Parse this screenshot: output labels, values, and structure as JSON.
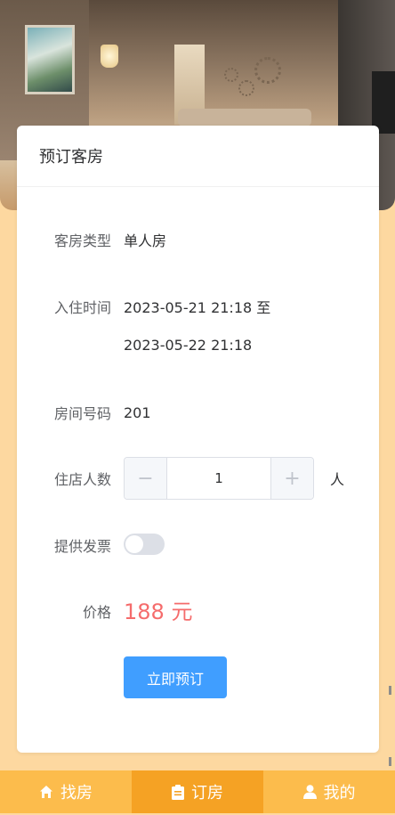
{
  "card": {
    "title": "预订客房"
  },
  "form": {
    "room_type_label": "客房类型",
    "room_type_value": "单人房",
    "checkin_label": "入住时间",
    "checkin_start": "2023-05-21 21:18 至",
    "checkin_end": "2023-05-22 21:18",
    "room_number_label": "房间号码",
    "room_number_value": "201",
    "guests_label": "住店人数",
    "guests_minus": "−",
    "guests_value": "1",
    "guests_plus": "+",
    "guests_unit": "人",
    "invoice_label": "提供发票",
    "invoice_enabled": false,
    "price_label": "价格",
    "price_value": "188 元",
    "book_button": "立即预订"
  },
  "tabbar": {
    "items": [
      {
        "label": "找房",
        "icon": "home-icon",
        "active": false
      },
      {
        "label": "订房",
        "icon": "clipboard-icon",
        "active": true
      },
      {
        "label": "我的",
        "icon": "user-icon",
        "active": false
      }
    ]
  },
  "colors": {
    "accent": "#409eff",
    "price": "#f56c6c",
    "tabbar": "#fcbc4c",
    "tab_active": "#f5a224",
    "background": "#fdd8a0"
  }
}
